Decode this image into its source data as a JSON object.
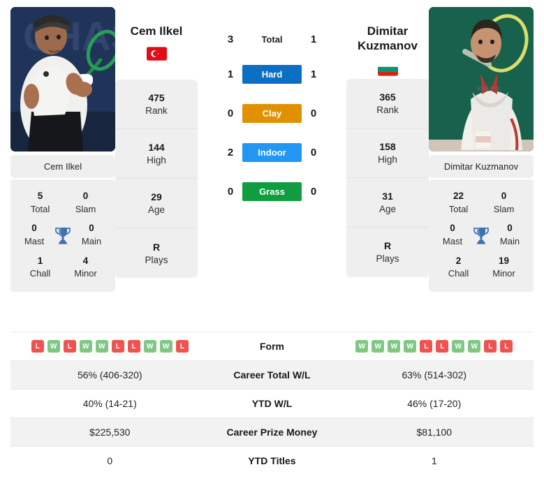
{
  "players": {
    "left": {
      "name": "Cem Ilkel",
      "caption": "Cem Ilkel",
      "flag": "turkey-flag",
      "rank": "475",
      "rank_label": "Rank",
      "high": "144",
      "high_label": "High",
      "age": "29",
      "age_label": "Age",
      "plays": "R",
      "plays_label": "Plays",
      "titles": {
        "total": "5",
        "total_label": "Total",
        "slam": "0",
        "slam_label": "Slam",
        "mast": "0",
        "mast_label": "Mast",
        "main": "0",
        "main_label": "Main",
        "chall": "1",
        "chall_label": "Chall",
        "minor": "4",
        "minor_label": "Minor"
      }
    },
    "right": {
      "name": "Dimitar Kuzmanov",
      "caption": "Dimitar Kuzmanov",
      "flag": "bulgaria-flag",
      "rank": "365",
      "rank_label": "Rank",
      "high": "158",
      "high_label": "High",
      "age": "31",
      "age_label": "Age",
      "plays": "R",
      "plays_label": "Plays",
      "titles": {
        "total": "22",
        "total_label": "Total",
        "slam": "0",
        "slam_label": "Slam",
        "mast": "0",
        "mast_label": "Mast",
        "main": "0",
        "main_label": "Main",
        "chall": "2",
        "chall_label": "Chall",
        "minor": "19",
        "minor_label": "Minor"
      }
    }
  },
  "h2h": {
    "rows": [
      {
        "label": "Total",
        "left": "3",
        "right": "1",
        "color": ""
      },
      {
        "label": "Hard",
        "left": "1",
        "right": "1",
        "color": "#0b6fc4"
      },
      {
        "label": "Clay",
        "left": "0",
        "right": "0",
        "color": "#e09000"
      },
      {
        "label": "Indoor",
        "left": "2",
        "right": "0",
        "color": "#2196f3"
      },
      {
        "label": "Grass",
        "left": "0",
        "right": "0",
        "color": "#0f9d3f"
      }
    ]
  },
  "stats": {
    "form_label": "Form",
    "left_form": [
      "L",
      "W",
      "L",
      "W",
      "W",
      "L",
      "L",
      "W",
      "W",
      "L"
    ],
    "right_form": [
      "W",
      "W",
      "W",
      "W",
      "L",
      "L",
      "W",
      "W",
      "L",
      "L"
    ],
    "rows": [
      {
        "label": "Career Total W/L",
        "left": "56% (406-320)",
        "right": "63% (514-302)"
      },
      {
        "label": "YTD W/L",
        "left": "40% (14-21)",
        "right": "46% (17-20)"
      },
      {
        "label": "Career Prize Money",
        "left": "$225,530",
        "right": "$81,100"
      },
      {
        "label": "YTD Titles",
        "left": "0",
        "right": "1"
      }
    ]
  },
  "colors": {
    "hard": "#0b6fc4",
    "clay": "#e09000",
    "indoor": "#2196f3",
    "grass": "#0f9d3f",
    "win": "#81c784",
    "loss": "#ef5350",
    "trophy": "#3f72ad"
  }
}
